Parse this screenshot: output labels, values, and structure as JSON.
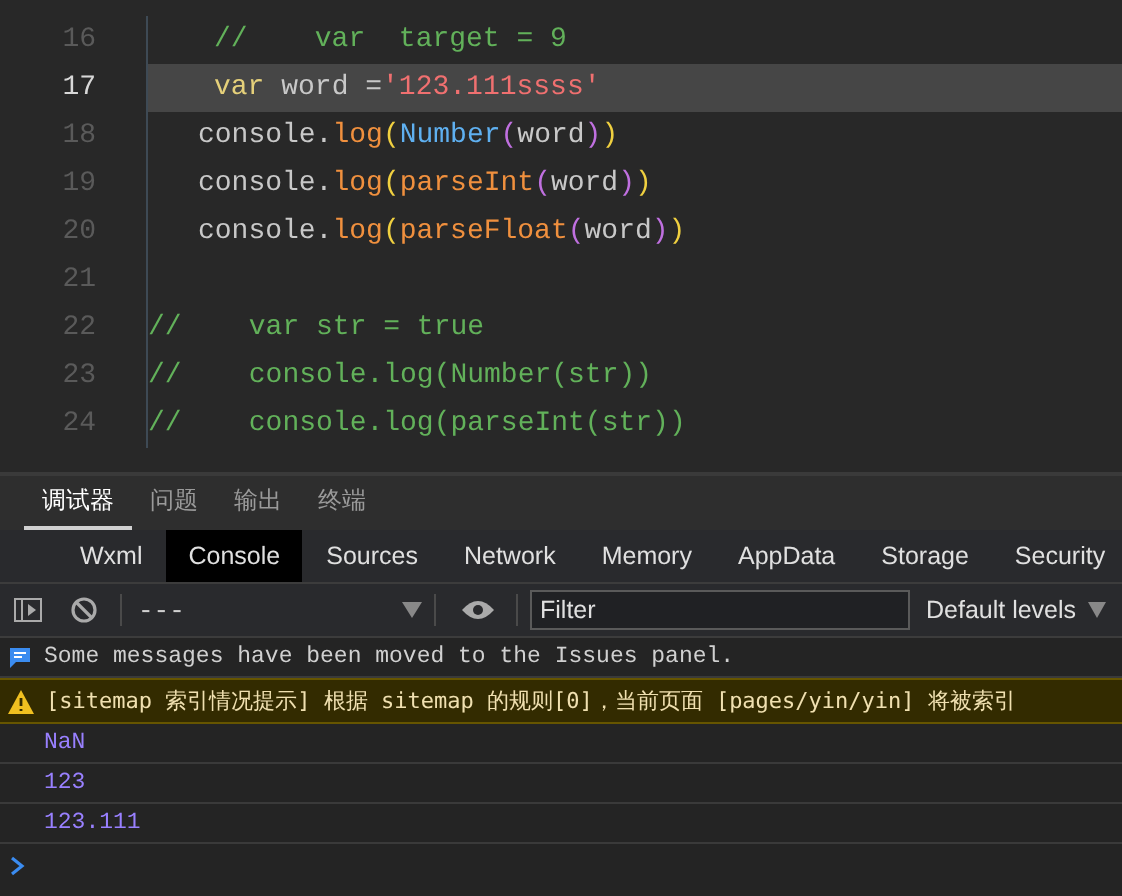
{
  "editor": {
    "lines": [
      {
        "number": "16",
        "current": false,
        "tokens": [
          {
            "kind": "comment",
            "text": "//    var  target = 9"
          }
        ]
      },
      {
        "number": "17",
        "current": true,
        "tokens": [
          {
            "kind": "keyword",
            "text": "var"
          },
          {
            "kind": "plain",
            "text": " word ="
          },
          {
            "kind": "string",
            "text": "'123.111ssss'"
          }
        ]
      },
      {
        "number": "18",
        "current": false,
        "tokens": [
          {
            "kind": "plain",
            "text": "console."
          },
          {
            "kind": "method",
            "text": "log"
          },
          {
            "kind": "paren1",
            "text": "("
          },
          {
            "kind": "builtin",
            "text": "Number"
          },
          {
            "kind": "paren2",
            "text": "("
          },
          {
            "kind": "plain",
            "text": "word"
          },
          {
            "kind": "paren2",
            "text": ")"
          },
          {
            "kind": "paren1",
            "text": ")"
          }
        ]
      },
      {
        "number": "19",
        "current": false,
        "tokens": [
          {
            "kind": "plain",
            "text": "console."
          },
          {
            "kind": "method",
            "text": "log"
          },
          {
            "kind": "paren1",
            "text": "("
          },
          {
            "kind": "method",
            "text": "parseInt"
          },
          {
            "kind": "paren2",
            "text": "("
          },
          {
            "kind": "plain",
            "text": "word"
          },
          {
            "kind": "paren2",
            "text": ")"
          },
          {
            "kind": "paren1",
            "text": ")"
          }
        ]
      },
      {
        "number": "20",
        "current": false,
        "tokens": [
          {
            "kind": "plain",
            "text": "console."
          },
          {
            "kind": "method",
            "text": "log"
          },
          {
            "kind": "paren1",
            "text": "("
          },
          {
            "kind": "method",
            "text": "parseFloat"
          },
          {
            "kind": "paren2",
            "text": "("
          },
          {
            "kind": "plain",
            "text": "word"
          },
          {
            "kind": "paren2",
            "text": ")"
          },
          {
            "kind": "paren1",
            "text": ")"
          }
        ]
      },
      {
        "number": "21",
        "current": false
      },
      {
        "number": "22",
        "current": false,
        "tokens": [
          {
            "kind": "comment",
            "text": "//    var str = true"
          }
        ]
      },
      {
        "number": "23",
        "current": false,
        "tokens": [
          {
            "kind": "comment",
            "text": "//    console.log(Number(str))"
          }
        ]
      },
      {
        "number": "24",
        "current": false,
        "tokens": [
          {
            "kind": "comment",
            "text": "//    console.log(parseInt(str))"
          }
        ]
      }
    ]
  },
  "panel_tabs": [
    {
      "label": "调试器",
      "selected": true
    },
    {
      "label": "问题",
      "selected": false
    },
    {
      "label": "输出",
      "selected": false
    },
    {
      "label": "终端",
      "selected": false
    }
  ],
  "devtools_tabs": [
    {
      "label": "Wxml",
      "selected": false
    },
    {
      "label": "Console",
      "selected": true
    },
    {
      "label": "Sources",
      "selected": false
    },
    {
      "label": "Network",
      "selected": false
    },
    {
      "label": "Memory",
      "selected": false
    },
    {
      "label": "AppData",
      "selected": false
    },
    {
      "label": "Storage",
      "selected": false
    },
    {
      "label": "Security",
      "selected": false
    }
  ],
  "toolbar": {
    "context": "---",
    "filter_placeholder": "Filter",
    "levels": "Default levels"
  },
  "messages": [
    {
      "kind": "info",
      "text": "Some messages have been moved to the Issues panel."
    },
    {
      "kind": "warning",
      "text": "[sitemap 索引情况提示] 根据 sitemap 的规则[0]，当前页面 [pages/yin/yin] 将被索引"
    },
    {
      "kind": "result",
      "text": "NaN"
    },
    {
      "kind": "result",
      "text": "123"
    },
    {
      "kind": "result",
      "text": "123.111"
    }
  ]
}
